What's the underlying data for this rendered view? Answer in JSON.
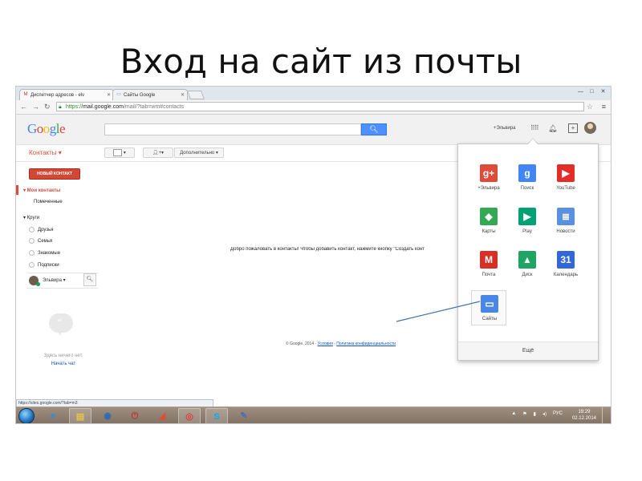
{
  "slide": {
    "title": "Вход на сайт из почты"
  },
  "browser": {
    "tabs": [
      {
        "label": "Диспетчер адресов - elv",
        "icon": "gmail-icon"
      },
      {
        "label": "Сайты Google",
        "icon": "sites-icon"
      }
    ],
    "url_https": "https://",
    "url_host": "mail.google.com",
    "url_path": "/mail/?tab=wm#contacts",
    "status_url": "https://sites.google.com/?tab=m3"
  },
  "header": {
    "logo": "Google",
    "user_link": "+Эльвира",
    "search_placeholder": ""
  },
  "toolbar": {
    "app_title": "Контакты ▾",
    "add_user_label": "▾",
    "more_label": "Дополнительно ▾"
  },
  "sidebar": {
    "new_contact": "НОВЫЙ КОНТАКТ",
    "my_contacts": "▾ Мои контакты",
    "starred": "Помеченные",
    "circles_header": "▾ Круги",
    "circles": [
      "Друзья",
      "Семья",
      "Знакомые",
      "Подписки"
    ],
    "hangouts_name": "Эльвира ▾",
    "empty_msg": "Здесь ничего нет.",
    "start_chat": "Начать чат"
  },
  "main": {
    "welcome": "Добро пожаловать в контакты! Чтобы добавить контакт, нажмите кнопку \"Создать конт",
    "footer_prefix": "© Google, 2014 - ",
    "footer_terms": "Условия",
    "footer_sep": " - ",
    "footer_privacy": "Политика конфиденциальности"
  },
  "apps_panel": {
    "apps": [
      {
        "label": "+Эльвира",
        "icon": "google-plus-icon",
        "glyph": "g+",
        "color": "#dd4b39"
      },
      {
        "label": "Поиск",
        "icon": "google-search-icon",
        "glyph": "g",
        "color": "#4285f4"
      },
      {
        "label": "YouTube",
        "icon": "youtube-icon",
        "glyph": "▶",
        "color": "#e52d27"
      },
      {
        "label": "Карты",
        "icon": "maps-icon",
        "glyph": "◆",
        "color": "#34a853"
      },
      {
        "label": "Play",
        "icon": "play-icon",
        "glyph": "▶",
        "color": "#00a173"
      },
      {
        "label": "Новости",
        "icon": "news-icon",
        "glyph": "≣",
        "color": "#5b8fe0"
      },
      {
        "label": "Почта",
        "icon": "gmail-icon",
        "glyph": "M",
        "color": "#d93025"
      },
      {
        "label": "Диск",
        "icon": "drive-icon",
        "glyph": "▲",
        "color": "#1fa463"
      },
      {
        "label": "Календарь",
        "icon": "calendar-icon",
        "glyph": "31",
        "color": "#3367d6"
      },
      {
        "label": "Сайты",
        "icon": "sites-icon",
        "glyph": "▭",
        "color": "#4a86e8"
      }
    ],
    "more": "Ещё"
  },
  "taskbar": {
    "apps": [
      {
        "icon": "internet-explorer-icon",
        "glyph": "e",
        "color": "#2d8fd5"
      },
      {
        "icon": "file-explorer-icon",
        "glyph": "▤",
        "color": "#e7c34a"
      },
      {
        "icon": "media-player-icon",
        "glyph": "◉",
        "color": "#2a6db5"
      },
      {
        "icon": "power-app-icon",
        "glyph": "⏻",
        "color": "#c0392b"
      },
      {
        "icon": "yandex-browser-icon",
        "glyph": "◢",
        "color": "#e04b3a"
      },
      {
        "icon": "chrome-icon",
        "glyph": "◎",
        "color": "#db4437"
      },
      {
        "icon": "skype-icon",
        "glyph": "S",
        "color": "#00aff0"
      },
      {
        "icon": "notes-app-icon",
        "glyph": "✎",
        "color": "#4f6fb0"
      }
    ],
    "lang": "РУС",
    "time": "19:29",
    "date": "02.12.2014"
  }
}
